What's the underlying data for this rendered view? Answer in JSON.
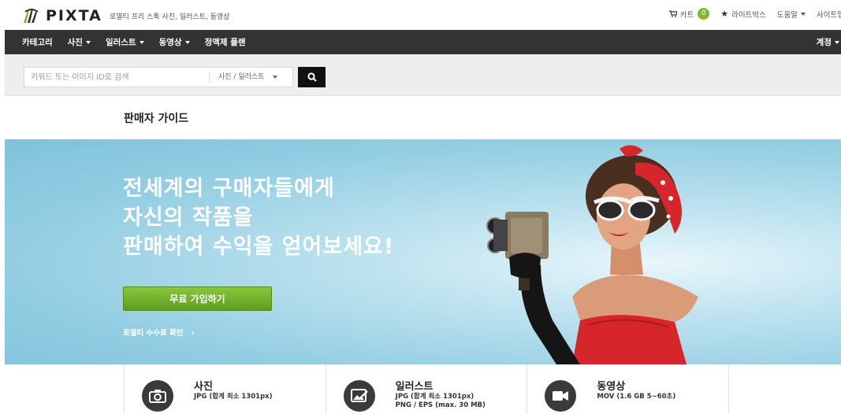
{
  "header": {
    "logo_text": "PIXTA",
    "tagline": "로열티 프리 스톡 사진, 일러스트, 동영상",
    "cart_label": "카트",
    "cart_count": "0",
    "lightbox_label": "라이트박스",
    "help_label": "도움말",
    "sitemap_label": "사이트맵"
  },
  "nav": {
    "items": [
      {
        "label": "카테고리"
      },
      {
        "label": "사진"
      },
      {
        "label": "일러스트"
      },
      {
        "label": "동영상"
      },
      {
        "label": "정액제 플랜"
      }
    ],
    "account_label": "계정"
  },
  "search": {
    "placeholder": "키워드 또는 이미지 ID로 검색",
    "type_selected": "사진 / 일러스트"
  },
  "page_title": "판매자 가이드",
  "hero": {
    "headline_line1": "전세계의 구매자들에게",
    "headline_line2": "자신의 작품을",
    "headline_line3": "판매하여 수익을 얻어보세요!",
    "cta_label": "무료 가입하기",
    "royalty_link": "로열티 수수료 확인"
  },
  "cards": [
    {
      "title": "사진",
      "spec": "JPG (합계 최소 1301px)",
      "icon": "camera-icon"
    },
    {
      "title": "일러스트",
      "spec": "JPG (합계 최소 1301px)\nPNG / EPS (max. 30 MB)",
      "icon": "illustration-icon"
    },
    {
      "title": "동영상",
      "spec": "MOV (1.6 GB 5~60초)",
      "icon": "video-camera-icon"
    }
  ],
  "colors": {
    "nav_bg": "#333333",
    "accent_green": "#7cb92e",
    "hero_bg": "#92cde2"
  }
}
